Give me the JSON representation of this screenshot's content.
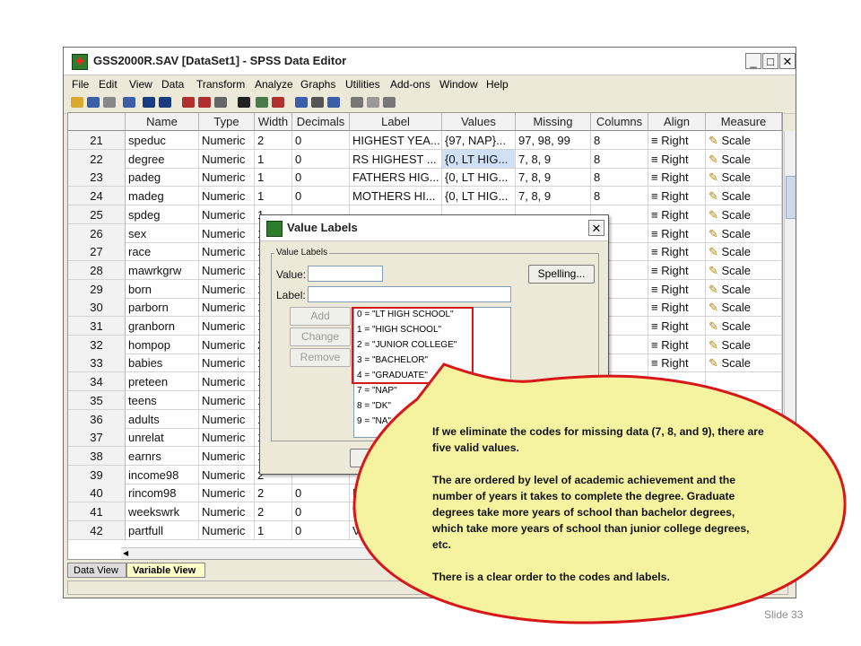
{
  "window": {
    "title": "GSS2000R.SAV [DataSet1] - SPSS Data Editor",
    "controls": [
      "_",
      "□",
      "✕"
    ]
  },
  "menu": [
    "File",
    "Edit",
    "View",
    "Data",
    "Transform",
    "Analyze",
    "Graphs",
    "Utilities",
    "Add-ons",
    "Window",
    "Help"
  ],
  "columns": [
    "Name",
    "Type",
    "Width",
    "Decimals",
    "Label",
    "Values",
    "Missing",
    "Columns",
    "Align",
    "Measure"
  ],
  "rows": [
    {
      "n": "21",
      "name": "speduc",
      "type": "Numeric",
      "width": "2",
      "dec": "0",
      "label": "HIGHEST YEA...",
      "values": "{97, NAP}...",
      "missing": "97, 98, 99",
      "cols": "8",
      "align": "Right",
      "measure": "Scale"
    },
    {
      "n": "22",
      "name": "degree",
      "type": "Numeric",
      "width": "1",
      "dec": "0",
      "label": "RS HIGHEST ...",
      "values": "{0, LT HIG...",
      "missing": "7, 8, 9",
      "cols": "8",
      "align": "Right",
      "measure": "Scale"
    },
    {
      "n": "23",
      "name": "padeg",
      "type": "Numeric",
      "width": "1",
      "dec": "0",
      "label": "FATHERS HIG...",
      "values": "{0, LT HIG...",
      "missing": "7, 8, 9",
      "cols": "8",
      "align": "Right",
      "measure": "Scale"
    },
    {
      "n": "24",
      "name": "madeg",
      "type": "Numeric",
      "width": "1",
      "dec": "0",
      "label": "MOTHERS HI...",
      "values": "{0, LT HIG...",
      "missing": "7, 8, 9",
      "cols": "8",
      "align": "Right",
      "measure": "Scale"
    },
    {
      "n": "25",
      "name": "spdeg",
      "type": "Numeric",
      "width": "1",
      "dec": "",
      "label": "",
      "values": "",
      "missing": "",
      "cols": "",
      "align": "Right",
      "measure": "Scale"
    },
    {
      "n": "26",
      "name": "sex",
      "type": "Numeric",
      "width": "1",
      "dec": "",
      "label": "",
      "values": "",
      "missing": "",
      "cols": "",
      "align": "Right",
      "measure": "Scale"
    },
    {
      "n": "27",
      "name": "race",
      "type": "Numeric",
      "width": "1",
      "dec": "",
      "label": "",
      "values": "",
      "missing": "",
      "cols": "",
      "align": "Right",
      "measure": "Scale"
    },
    {
      "n": "28",
      "name": "mawrkgrw",
      "type": "Numeric",
      "width": "1",
      "dec": "",
      "label": "",
      "values": "",
      "missing": "",
      "cols": "",
      "align": "Right",
      "measure": "Scale"
    },
    {
      "n": "29",
      "name": "born",
      "type": "Numeric",
      "width": "1",
      "dec": "",
      "label": "",
      "values": "",
      "missing": "",
      "cols": "",
      "align": "Right",
      "measure": "Scale"
    },
    {
      "n": "30",
      "name": "parborn",
      "type": "Numeric",
      "width": "1",
      "dec": "",
      "label": "",
      "values": "",
      "missing": "",
      "cols": "",
      "align": "Right",
      "measure": "Scale"
    },
    {
      "n": "31",
      "name": "granborn",
      "type": "Numeric",
      "width": "1",
      "dec": "",
      "label": "",
      "values": "",
      "missing": "",
      "cols": "",
      "align": "Right",
      "measure": "Scale"
    },
    {
      "n": "32",
      "name": "hompop",
      "type": "Numeric",
      "width": "2",
      "dec": "",
      "label": "",
      "values": "",
      "missing": "",
      "cols": "",
      "align": "Right",
      "measure": "Scale"
    },
    {
      "n": "33",
      "name": "babies",
      "type": "Numeric",
      "width": "1",
      "dec": "",
      "label": "",
      "values": "",
      "missing": "",
      "cols": "",
      "align": "Right",
      "measure": "Scale"
    },
    {
      "n": "34",
      "name": "preteen",
      "type": "Numeric",
      "width": "1",
      "dec": "",
      "label": "",
      "values": "",
      "missing": "",
      "cols": "",
      "align": "",
      "measure": ""
    },
    {
      "n": "35",
      "name": "teens",
      "type": "Numeric",
      "width": "1",
      "dec": "",
      "label": "",
      "values": "",
      "missing": "",
      "cols": "",
      "align": "",
      "measure": ""
    },
    {
      "n": "36",
      "name": "adults",
      "type": "Numeric",
      "width": "1",
      "dec": "",
      "label": "",
      "values": "",
      "missing": "",
      "cols": "",
      "align": "",
      "measure": ""
    },
    {
      "n": "37",
      "name": "unrelat",
      "type": "Numeric",
      "width": "1",
      "dec": "",
      "label": "",
      "values": "",
      "missing": "",
      "cols": "",
      "align": "",
      "measure": ""
    },
    {
      "n": "38",
      "name": "earnrs",
      "type": "Numeric",
      "width": "1",
      "dec": "",
      "label": "",
      "values": "",
      "missing": "",
      "cols": "",
      "align": "",
      "measure": ""
    },
    {
      "n": "39",
      "name": "income98",
      "type": "Numeric",
      "width": "2",
      "dec": "",
      "label": "",
      "values": "",
      "missing": "",
      "cols": "",
      "align": "",
      "measure": ""
    },
    {
      "n": "40",
      "name": "rincom98",
      "type": "Numeric",
      "width": "2",
      "dec": "0",
      "label": "R",
      "values": "",
      "missing": "",
      "cols": "",
      "align": "",
      "measure": ""
    },
    {
      "n": "41",
      "name": "weekswrk",
      "type": "Numeric",
      "width": "2",
      "dec": "0",
      "label": "V",
      "values": "",
      "missing": "",
      "cols": "",
      "align": "",
      "measure": ""
    },
    {
      "n": "42",
      "name": "partfull",
      "type": "Numeric",
      "width": "1",
      "dec": "0",
      "label": "V",
      "values": "",
      "missing": "",
      "cols": "",
      "align": "",
      "measure": ""
    }
  ],
  "tabs": [
    "Data View",
    "Variable View"
  ],
  "dialog": {
    "title": "Value Labels",
    "group_label": "Value Labels",
    "value_label": "Value:",
    "label_label": "Label:",
    "add": "Add",
    "change": "Change",
    "remove": "Remove",
    "spelling": "Spelling...",
    "list": [
      "0 = \"LT HIGH SCHOOL\"",
      "1 = \"HIGH SCHOOL\"",
      "2 = \"JUNIOR COLLEGE\"",
      "3 = \"BACHELOR\"",
      "4 = \"GRADUATE\"",
      "7 = \"NAP\"",
      "8 = \"DK\"",
      "9 = \"NA\""
    ]
  },
  "callout": {
    "p1": "If we eliminate the codes for missing data (7, 8, and 9), there are five valid values.",
    "p2": "The are ordered by level of academic achievement and the number of years it takes to complete the degree. Graduate degrees take more years of school than bachelor degrees, which take more years of school than junior college degrees, etc.",
    "p3": "There is a clear order to the codes and labels.",
    "fill": "#f5f3a0",
    "stroke": "#d81818"
  },
  "slide": "Slide 33"
}
